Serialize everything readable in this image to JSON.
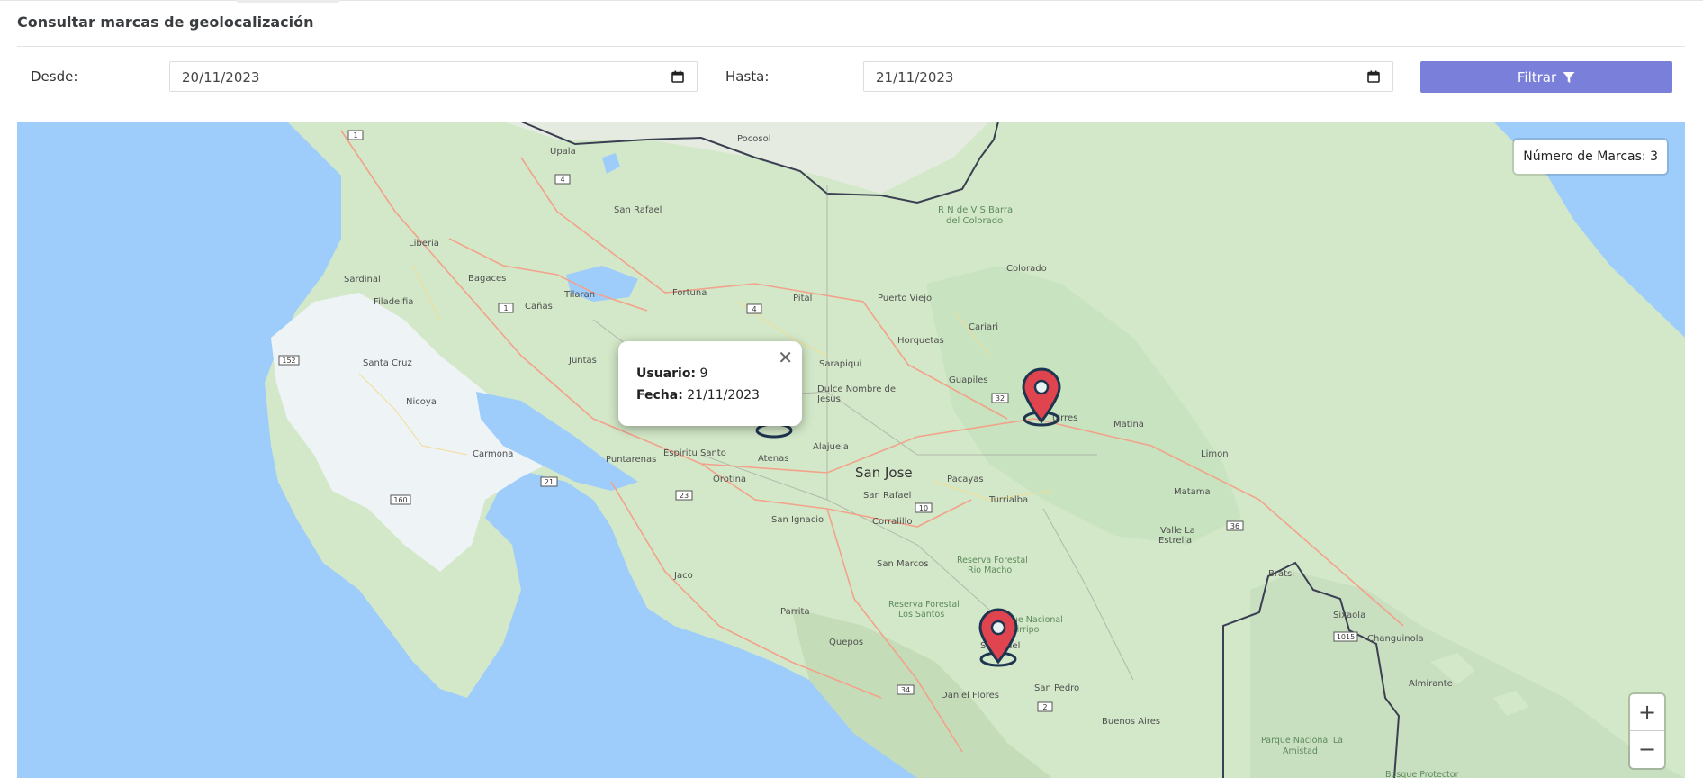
{
  "page": {
    "title": "Consultar marcas de geolocalización"
  },
  "filters": {
    "from_label": "Desde:",
    "from_value": "20/11/2023",
    "to_label": "Hasta:",
    "to_value": "21/11/2023",
    "filter_label": "Filtrar"
  },
  "map": {
    "marker_count_text": "Número de Marcas: 3",
    "popup": {
      "user_label": "Usuario:",
      "user_value": "9",
      "date_label": "Fecha:",
      "date_value": "21/11/2023"
    },
    "zoom_in": "+",
    "zoom_out": "−",
    "marker_color": "#e0444f",
    "places": {
      "san_jose": "San Jose",
      "liberia": "Liberia",
      "upala": "Upala",
      "san_rafael_n": "San Rafael",
      "pocosol": "Pocosol",
      "bagaces": "Bagaces",
      "sardinal": "Sardinal",
      "filadelfia": "Filadelfia",
      "tilaran": "Tilaran",
      "fortuna": "Fortuna",
      "pital": "Pital",
      "puerto_viejo": "Puerto Viejo",
      "rn_barra": "R N de V S Barra",
      "del_colorado": "del Colorado",
      "colorado": "Colorado",
      "canas": "Cañas",
      "santa_cruz": "Santa Cruz",
      "juntas": "Juntas",
      "sarapiqui": "Sarapiqui",
      "horquetas": "Horquetas",
      "cariari": "Cariari",
      "guapiles": "Guapiles",
      "dulce_nombre": "Dulce Nombre de",
      "jesus": "Jesus",
      "siquirres": "uirres",
      "matina": "Matina",
      "limon": "Limon",
      "nicoya": "Nicoya",
      "carmona": "Carmona",
      "puntarenas": "Puntarenas",
      "espiritu_santo": "Espiritu Santo",
      "alajuela": "Alajuela",
      "atenas": "Atenas",
      "orotina": "Orotina",
      "pacayas": "Pacayas",
      "san_rafael_s": "San Rafael",
      "turrialba": "Turrialba",
      "matama": "Matama",
      "san_ignacio": "San Ignacio",
      "corralillo": "Corralillo",
      "valle_la": "Valle La",
      "estrella": "Estrella",
      "san_marcos": "San Marcos",
      "rf_rio_macho_1": "Reserva Forestal",
      "rf_rio_macho_2": "Rio Macho",
      "jaco": "Jaco",
      "bratsi": "Bratsi",
      "rf_los_santos_1": "Reserva Forestal",
      "rf_los_santos_2": "Los Santos",
      "pn_chirripo_1": "Parque Nacional",
      "pn_chirripo_2": "Chirripo",
      "san_isidro": "S    dro del",
      "sixaola": "Sixaola",
      "changuinola": "Changuinola",
      "parrita": "Parrita",
      "quepos": "Quepos",
      "almirante": "Almirante",
      "daniel_flores": "Daniel Flores",
      "san_pedro": "San Pedro",
      "buenos_aires": "Buenos Aires",
      "pn_amistad_1": "Parque Nacional La",
      "pn_amistad_2": "Amistad",
      "bosque_protector": "Bosque Protector"
    },
    "shields": [
      "1",
      "4",
      "4",
      "1",
      "152",
      "21",
      "160",
      "23",
      "10",
      "32",
      "36",
      "1015",
      "34",
      "2"
    ]
  }
}
